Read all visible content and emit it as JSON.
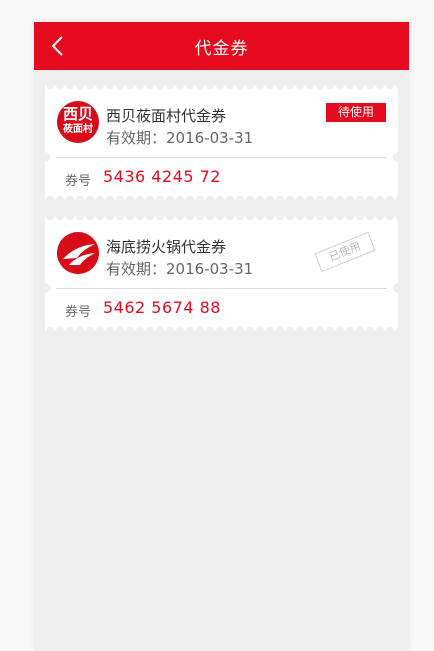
{
  "header": {
    "title": "代金券",
    "back_icon": "chevron-left-icon"
  },
  "colors": {
    "brand_red": "#e60a1e",
    "background": "#eeeeee"
  },
  "coupons": [
    {
      "name": "西贝莜面村代金券",
      "expiry": "有效期：2016-03-31",
      "status": "待使用",
      "code_label": "券号",
      "code": "5436 4245 72",
      "logo_line1": "西贝",
      "logo_line2": "莜面村"
    },
    {
      "name": "海底捞火锅代金券",
      "expiry": "有效期：2016-03-31",
      "status": "已使用",
      "code_label": "券号",
      "code": "5462 5674 88"
    }
  ]
}
